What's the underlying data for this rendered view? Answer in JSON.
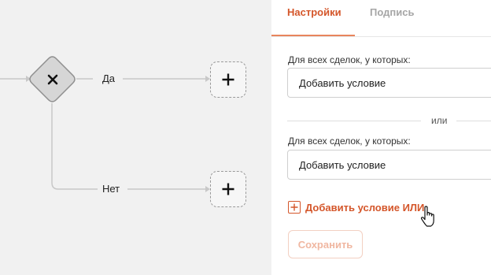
{
  "flow": {
    "branches": [
      {
        "label": "Да"
      },
      {
        "label": "Нет"
      }
    ],
    "add_node_symbol": "+"
  },
  "panel": {
    "tabs": [
      {
        "label": "Настройки",
        "active": true
      },
      {
        "label": "Подпись",
        "active": false
      }
    ],
    "conditions": [
      {
        "label": "Для всех сделок, у которых:",
        "placeholder": "Добавить условие"
      },
      {
        "label": "Для всех сделок, у которых:",
        "placeholder": "Добавить условие"
      }
    ],
    "or_separator": "или",
    "add_or_condition": "Добавить условие ИЛИ",
    "save": "Сохранить"
  },
  "colors": {
    "accent": "#d4562a",
    "accent_light": "#f0b7a1",
    "canvas_bg": "#f1f1f1",
    "connector": "#c8c8c8"
  },
  "icons": {
    "gateway": "close-icon",
    "add_node": "plus-icon",
    "add_or": "plus-square-icon",
    "cursor": "hand-pointer-icon"
  }
}
